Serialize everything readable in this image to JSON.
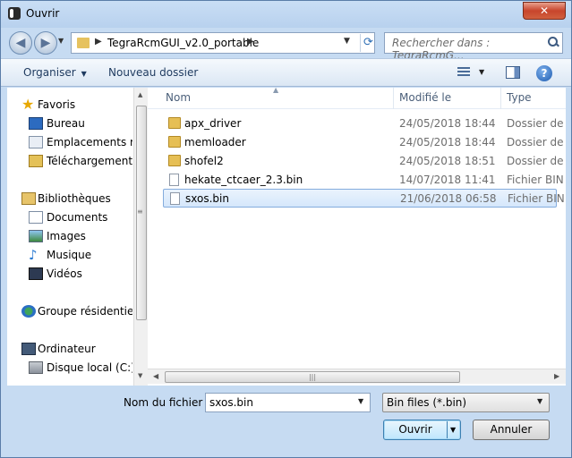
{
  "window": {
    "title": "Ouvrir",
    "close": "✕"
  },
  "nav": {
    "path": "TegraRcmGUI_v2.0_portable",
    "search_placeholder": "Rechercher dans : TegraRcmG..."
  },
  "toolbar": {
    "organize": "Organiser",
    "new_folder": "Nouveau dossier"
  },
  "sidebar": {
    "favorites": "Favoris",
    "fav_items": [
      "Bureau",
      "Emplacements ré",
      "Téléchargements"
    ],
    "libraries": "Bibliothèques",
    "lib_items": [
      "Documents",
      "Images",
      "Musique",
      "Vidéos"
    ],
    "homegroup": "Groupe résidentiel",
    "computer": "Ordinateur",
    "comp_items": [
      "Disque local (C:)"
    ]
  },
  "columns": {
    "name": "Nom",
    "modified": "Modifié le",
    "type": "Type"
  },
  "files": [
    {
      "name": "apx_driver",
      "date": "24/05/2018 18:44",
      "type": "Dossier de fic",
      "kind": "folder"
    },
    {
      "name": "memloader",
      "date": "24/05/2018 18:44",
      "type": "Dossier de fic",
      "kind": "folder"
    },
    {
      "name": "shofel2",
      "date": "24/05/2018 18:51",
      "type": "Dossier de fic",
      "kind": "folder"
    },
    {
      "name": "hekate_ctcaer_2.3.bin",
      "date": "14/07/2018 11:41",
      "type": "Fichier BIN",
      "kind": "file"
    },
    {
      "name": "sxos.bin",
      "date": "21/06/2018 06:58",
      "type": "Fichier BIN",
      "kind": "file",
      "selected": true
    }
  ],
  "bottom": {
    "filename_label": "Nom du fichier :",
    "filename_value": "sxos.bin",
    "filter_value": "Bin files (*.bin)",
    "open": "Ouvrir",
    "cancel": "Annuler"
  }
}
